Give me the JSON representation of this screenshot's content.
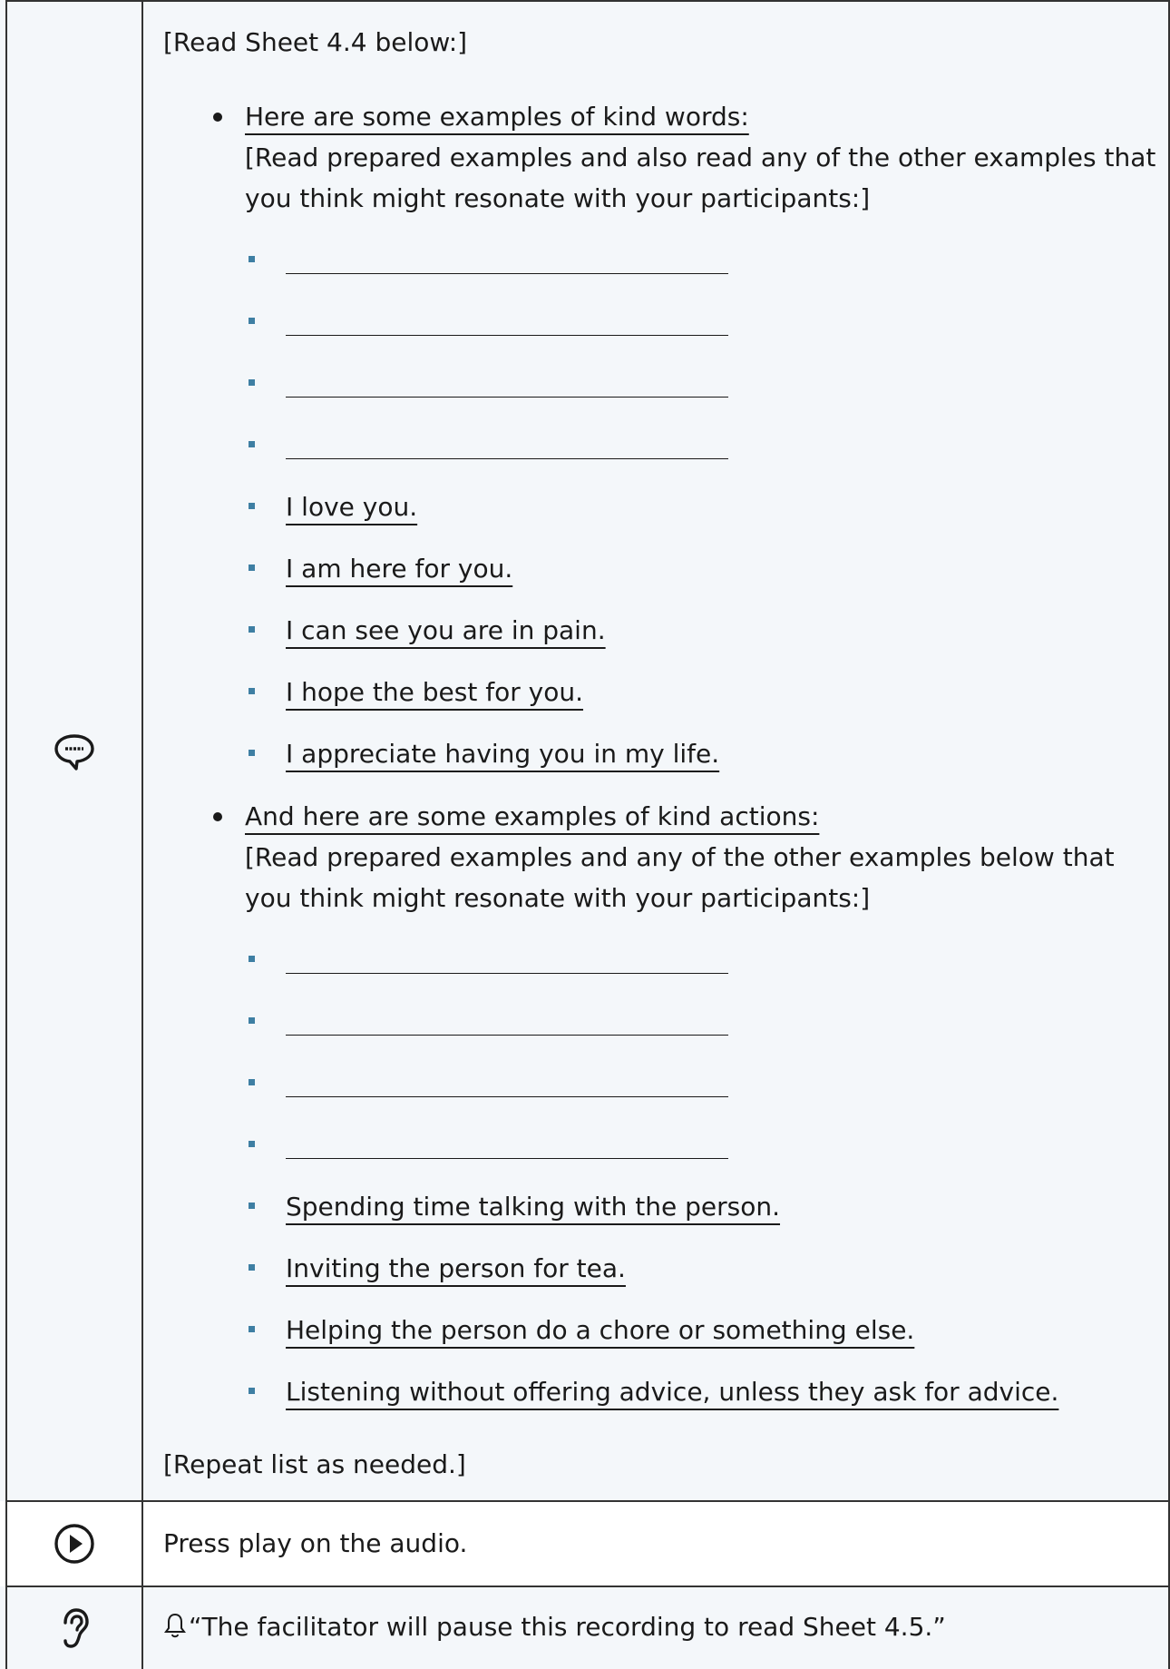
{
  "main": {
    "intro": "[Read Sheet 4.4 below:]",
    "words": {
      "heading": "Here are some examples of kind words:",
      "instruction": "[Read prepared examples and also read any of the other examples that you think might resonate with your participants:]",
      "examples": [
        "I love you.",
        "I am here for you.",
        "I can see you are in pain.",
        "I hope the best for you.",
        "I appreciate having you in my life."
      ]
    },
    "actions": {
      "heading": "And here are some examples of kind actions:",
      "instruction": "[Read prepared examples and any of the other examples below that you think might resonate with your participants:]",
      "examples": [
        "Spending time talking with the person.",
        "Inviting the person for tea.",
        "Helping the person do a chore or something else.",
        "Listening without offering advice, unless they ask for advice."
      ]
    },
    "outro": "[Repeat list as needed.]",
    "row_icon": "speech-bubble-icon",
    "row_bg": "#f4f7fa",
    "bullet_color": "#3e7fa3"
  },
  "play_row": {
    "icon": "play-icon",
    "text": "Press play on the audio."
  },
  "listen_row": {
    "icon": "ear-icon",
    "bell_icon": "bell-icon",
    "text": "“The facilitator will pause this recording to read Sheet 4.5.”"
  }
}
